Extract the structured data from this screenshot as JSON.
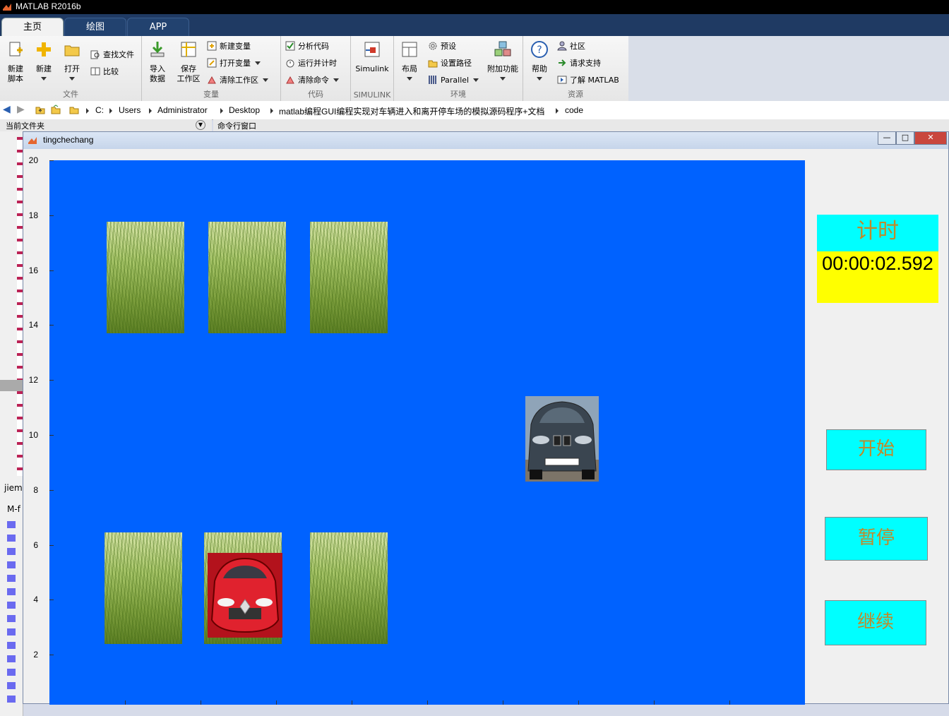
{
  "app": {
    "title": "MATLAB R2016b"
  },
  "tabs": [
    {
      "label": "主页",
      "active": true
    },
    {
      "label": "绘图",
      "active": false
    },
    {
      "label": "APP",
      "active": false
    }
  ],
  "ribbon": {
    "file": {
      "label": "文件",
      "new_script": "新建\n脚本",
      "new": "新建",
      "open": "打开",
      "find_files": "查找文件",
      "compare": "比较"
    },
    "variable": {
      "label": "变量",
      "import_data": "导入\n数据",
      "save_workspace": "保存\n工作区",
      "new_variable": "新建变量",
      "open_variable": "打开变量",
      "clear_workspace": "清除工作区"
    },
    "code": {
      "label": "代码",
      "analyze_code": "分析代码",
      "run_and_time": "运行并计时",
      "clear_commands": "清除命令"
    },
    "simulink": {
      "label": "SIMULINK",
      "simulink": "Simulink"
    },
    "environment": {
      "label": "环境",
      "layout": "布局",
      "preferences": "预设",
      "set_path": "设置路径",
      "parallel": "Parallel",
      "addons": "附加功能"
    },
    "resources": {
      "label": "资源",
      "help": "帮助",
      "community": "社区",
      "request_support": "请求支持",
      "learn_matlab": "了解 MATLAB"
    }
  },
  "address": {
    "crumbs": [
      "C:",
      "Users",
      "Administrator",
      "Desktop",
      "matlab编程GUI编程实现对车辆进入和离开停车场的模拟源码程序+文档",
      "code"
    ]
  },
  "panes": {
    "current_folder": "当前文件夹",
    "command_window": "命令行窗口",
    "left_partial_1": "jiem",
    "left_partial_2": "M-f"
  },
  "figure": {
    "title": "tingchechang",
    "minimize": "—",
    "maximize": "□",
    "close": "✕"
  },
  "axes": {
    "ylim": [
      0,
      20
    ],
    "yticks": [
      "20",
      "18",
      "16",
      "14",
      "12",
      "10",
      "8",
      "6",
      "4",
      "2"
    ]
  },
  "timer": {
    "label": "计时",
    "value": "00:00:02.592",
    "label_bg": "#00ffff",
    "value_bg": "#ffff00"
  },
  "buttons": {
    "start": "开始",
    "pause": "暂停",
    "continue": "继续"
  },
  "colors": {
    "axes_bg": "#0062ff",
    "button_bg": "#00ffff"
  }
}
